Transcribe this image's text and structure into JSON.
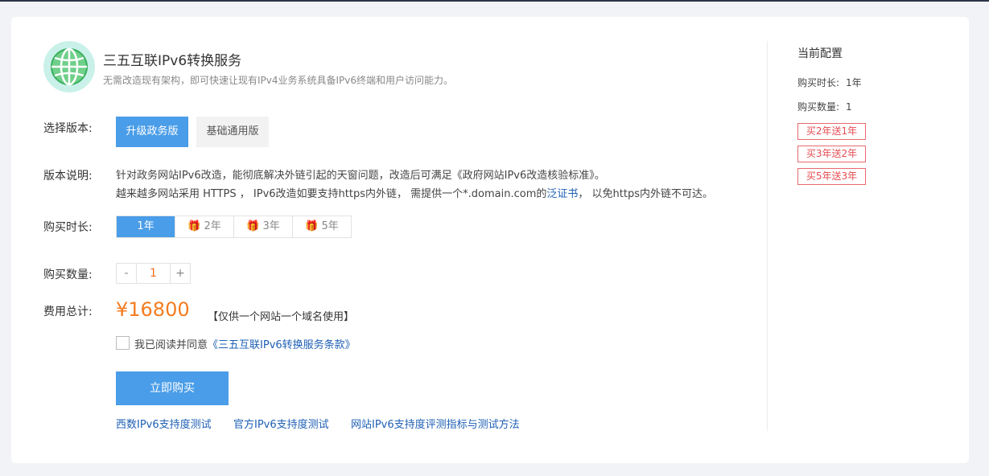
{
  "product": {
    "title": "三五互联IPv6转换服务",
    "subtitle": "无需改造现有架构，即可快速让现有IPv4业务系统具备IPv6终端和用户访问能力。"
  },
  "version": {
    "label": "选择版本:",
    "options": [
      "升级政务版",
      "基础通用版"
    ],
    "selected": "升级政务版"
  },
  "description": {
    "label": "版本说明:",
    "line1": "针对政务网站IPv6改造，能彻底解决外链引起的天窗问题，改造后可满足《政府网站IPv6改造核验标准》。",
    "line2_prefix": "越来越多网站采用 HTTPS ， IPv6改造如要支持https内外链， 需提供一个*.domain.com的",
    "line2_link": "泛证书",
    "line2_suffix": "， 以免https内外链不可达。"
  },
  "duration": {
    "label": "购买时长:",
    "options": [
      "1年",
      "2年",
      "3年",
      "5年"
    ],
    "selected": "1年"
  },
  "quantity": {
    "label": "购买数量:",
    "minus": "-",
    "value": "1",
    "plus": "+"
  },
  "cost": {
    "label": "费用总计:",
    "price": "¥16800",
    "note": "【仅供一个网站一个域名使用】"
  },
  "agreement": {
    "text": "我已阅读并同意",
    "link": "《三五互联IPv6转换服务条款》",
    "checked": false
  },
  "buy_button": "立即购买",
  "footer_links": [
    "西数IPv6支持度测试",
    "官方IPv6支持度测试",
    "网站IPv6支持度评测指标与测试方法"
  ],
  "sidebar": {
    "title": "当前配置",
    "duration_label": "购买时长:",
    "duration_value": "1年",
    "quantity_label": "购买数量:",
    "quantity_value": "1",
    "promos": [
      "买2年送1年",
      "买3年送2年",
      "买5年送3年"
    ]
  },
  "colors": {
    "accent": "#4a9de8",
    "price": "#f47c20",
    "promo": "#e64c52",
    "link": "#1e5fb4"
  }
}
